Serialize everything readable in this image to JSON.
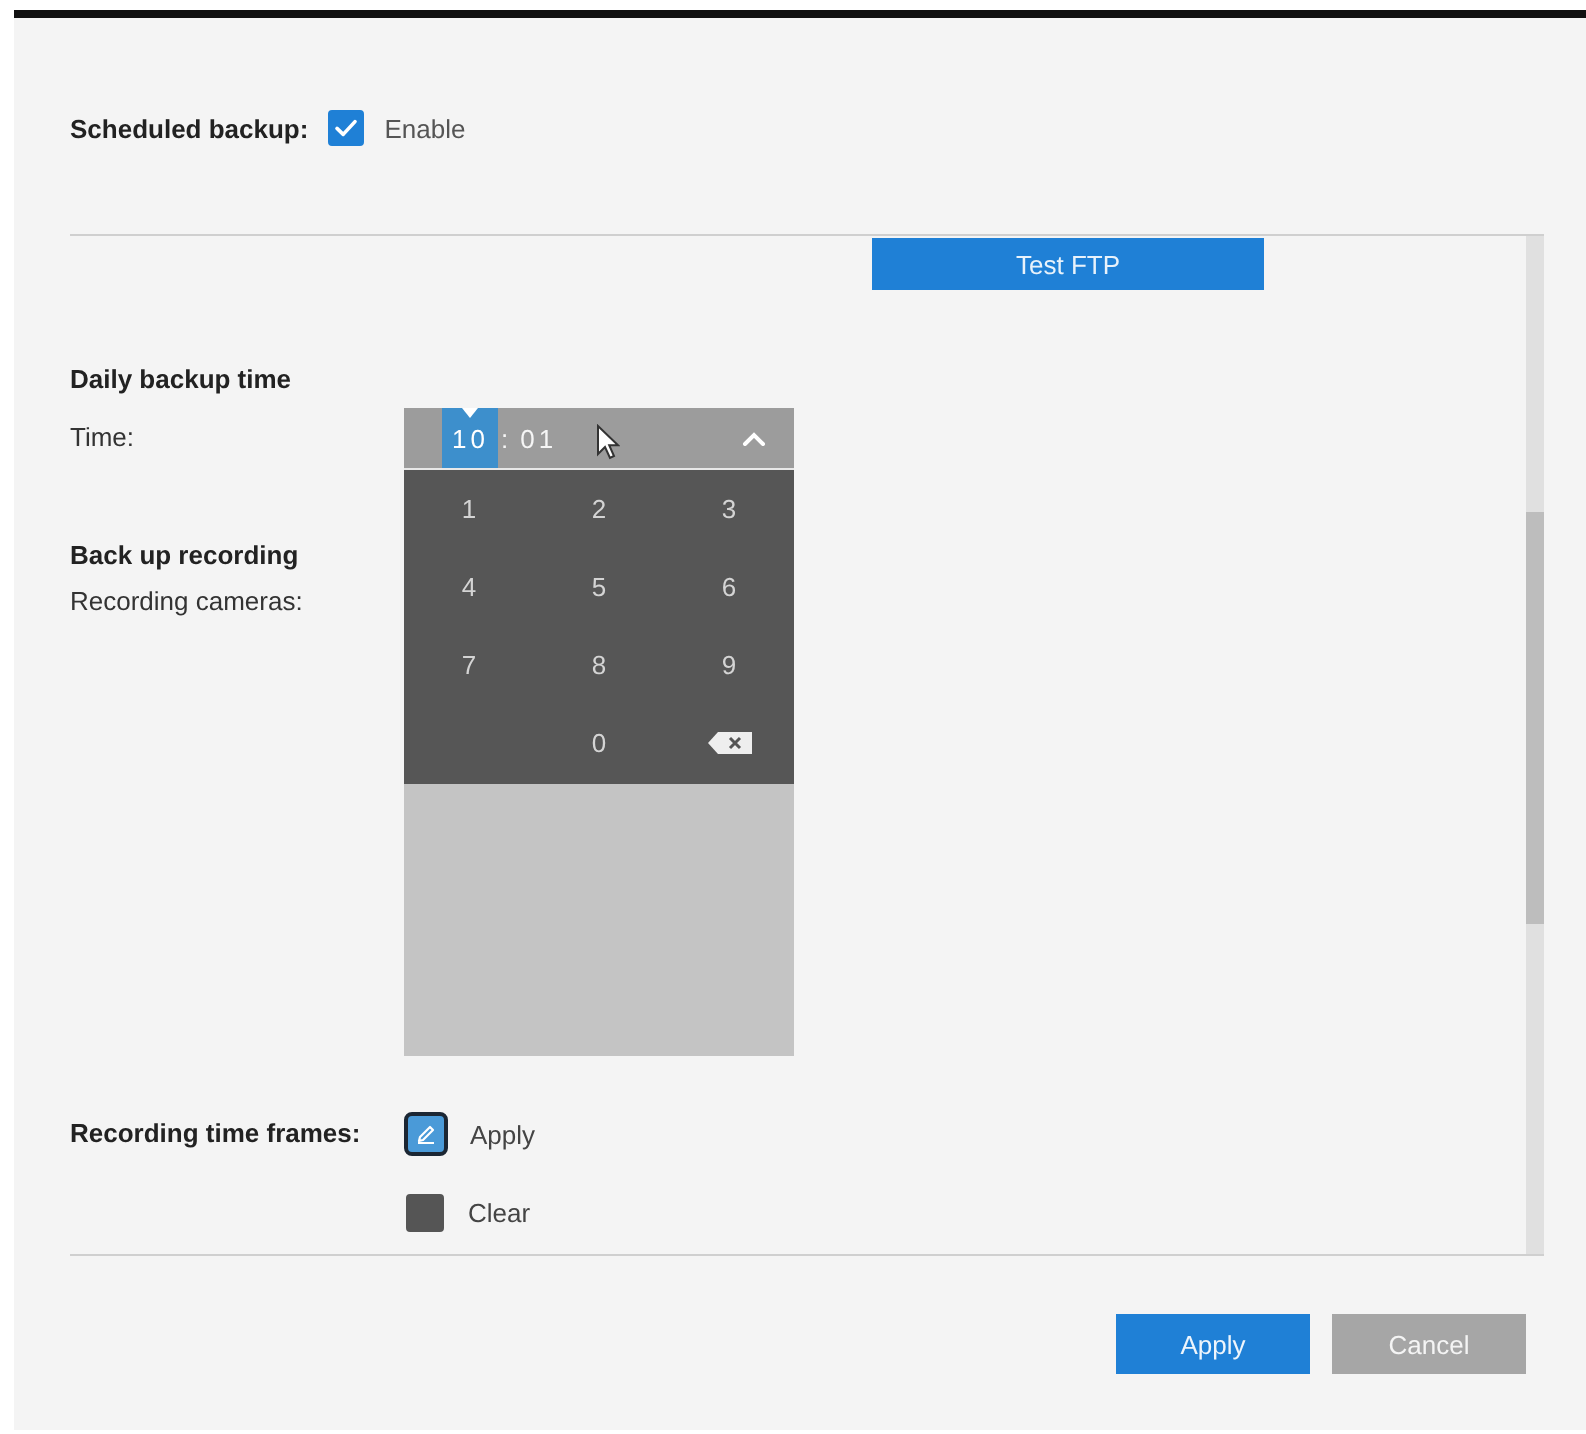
{
  "scheduled_backup": {
    "label": "Scheduled backup:",
    "checkbox": {
      "label": "Enable",
      "checked": true
    }
  },
  "test_ftp_button": {
    "label": "Test FTP"
  },
  "daily_backup_time": {
    "heading": "Daily backup time",
    "time_label": "Time:",
    "time_picker": {
      "segments": [
        {
          "text": "10",
          "selected": true
        },
        {
          "text": "01",
          "selected": false
        }
      ],
      "separator": ":",
      "expanded": true,
      "keys": [
        {
          "kind": "digit",
          "label": "1"
        },
        {
          "kind": "digit",
          "label": "2"
        },
        {
          "kind": "digit",
          "label": "3"
        },
        {
          "kind": "digit",
          "label": "4"
        },
        {
          "kind": "digit",
          "label": "5"
        },
        {
          "kind": "digit",
          "label": "6"
        },
        {
          "kind": "digit",
          "label": "7"
        },
        {
          "kind": "digit",
          "label": "8"
        },
        {
          "kind": "digit",
          "label": "9"
        },
        {
          "kind": "blank"
        },
        {
          "kind": "digit",
          "label": "0"
        },
        {
          "kind": "backspace"
        }
      ]
    }
  },
  "back_up_recording": {
    "heading": "Back up recording",
    "cameras_label": "Recording cameras:"
  },
  "recording_time_frames": {
    "label": "Recording time frames:",
    "tools": [
      {
        "kind": "pen",
        "label": "Apply",
        "selected": true
      },
      {
        "kind": "swatch",
        "label": "Clear",
        "selected": false
      }
    ]
  },
  "buttons": [
    {
      "kind": "primary",
      "label": "Apply"
    },
    {
      "kind": "secondary",
      "label": "Cancel"
    }
  ]
}
